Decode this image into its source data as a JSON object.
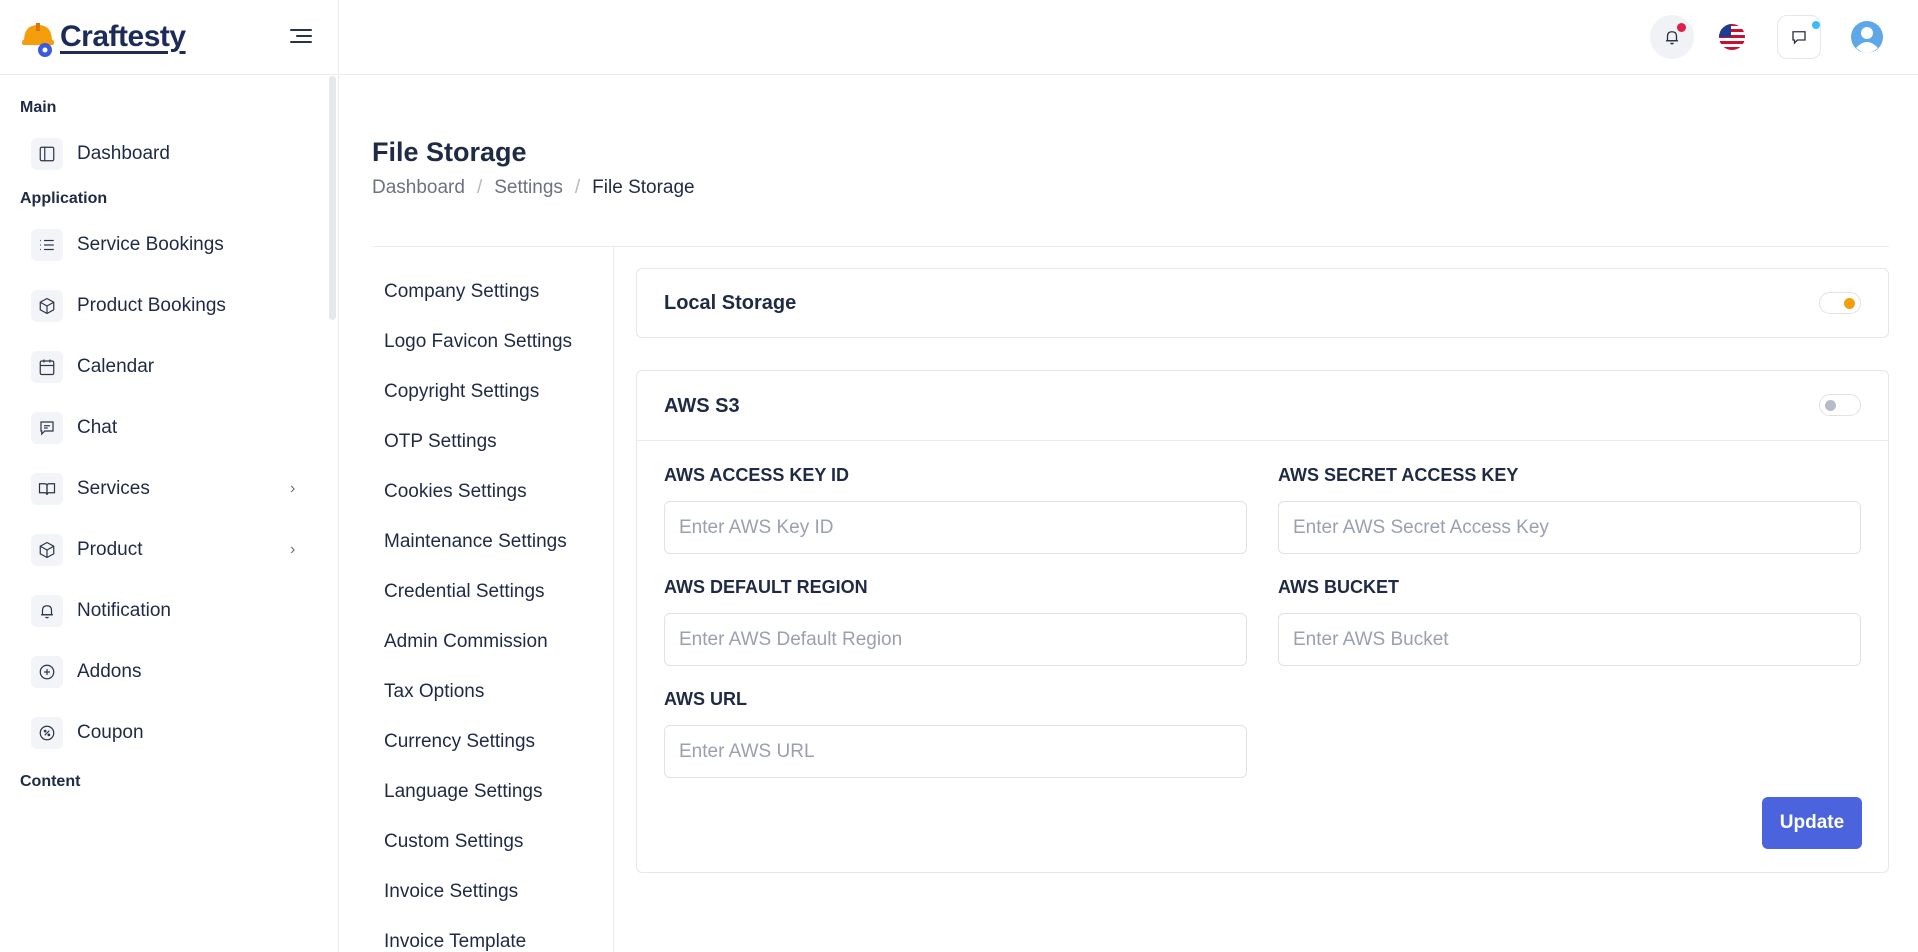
{
  "brand": {
    "name": "Craftesty"
  },
  "sidebar": {
    "sections": {
      "main": "Main",
      "application": "Application",
      "content": "Content"
    },
    "items": [
      {
        "label": "Dashboard",
        "icon": "layout-icon"
      },
      {
        "label": "Service Bookings",
        "icon": "list-icon"
      },
      {
        "label": "Product Bookings",
        "icon": "box-icon"
      },
      {
        "label": "Calendar",
        "icon": "calendar-icon"
      },
      {
        "label": "Chat",
        "icon": "message-icon"
      },
      {
        "label": "Services",
        "icon": "book-icon",
        "has_children": true
      },
      {
        "label": "Product",
        "icon": "box-icon",
        "has_children": true
      },
      {
        "label": "Notification",
        "icon": "bell-icon"
      },
      {
        "label": "Addons",
        "icon": "plus-circle-icon"
      },
      {
        "label": "Coupon",
        "icon": "percent-icon"
      }
    ]
  },
  "topbar": {
    "notification_dot_color": "#e11d48",
    "chat_dot_color": "#38bdf8"
  },
  "page": {
    "title": "File Storage",
    "breadcrumb": [
      "Dashboard",
      "Settings",
      "File Storage"
    ]
  },
  "settings_menu": [
    "Company Settings",
    "Logo Favicon Settings",
    "Copyright Settings",
    "OTP Settings",
    "Cookies Settings",
    "Maintenance Settings",
    "Credential Settings",
    "Admin Commission",
    "Tax Options",
    "Currency Settings",
    "Language Settings",
    "Custom Settings",
    "Invoice Settings",
    "Invoice Template"
  ],
  "local_storage": {
    "title": "Local Storage",
    "enabled": true,
    "knob_color": "#f59e0b"
  },
  "aws": {
    "title": "AWS S3",
    "enabled": false,
    "knob_color": "#b8bcc6",
    "fields": {
      "access_key": {
        "label": "AWS ACCESS KEY ID",
        "placeholder": "Enter AWS Key ID",
        "value": ""
      },
      "secret_key": {
        "label": "AWS SECRET ACCESS KEY",
        "placeholder": "Enter AWS Secret Access Key",
        "value": ""
      },
      "region": {
        "label": "AWS DEFAULT REGION",
        "placeholder": "Enter AWS Default Region",
        "value": ""
      },
      "bucket": {
        "label": "AWS BUCKET",
        "placeholder": "Enter AWS Bucket",
        "value": ""
      },
      "url": {
        "label": "AWS URL",
        "placeholder": "Enter AWS URL",
        "value": ""
      }
    },
    "update_label": "Update",
    "accent_color": "#4b63dc"
  }
}
